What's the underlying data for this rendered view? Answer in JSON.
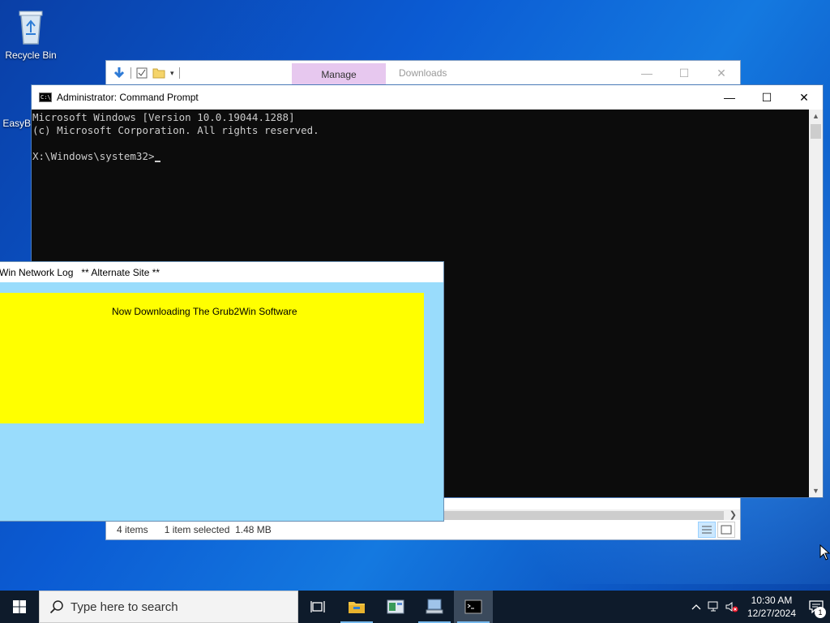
{
  "desktop": {
    "icons": [
      {
        "label": "Recycle Bin",
        "icon": "recycle-bin-icon"
      },
      {
        "label": "EasyB",
        "icon": "easybcd-icon"
      }
    ]
  },
  "explorer": {
    "manage_tab": "Manage",
    "title": "Downloads",
    "status": {
      "items": "4 items",
      "selected": "1 item selected  1.48 MB"
    }
  },
  "cmd": {
    "title": "Administrator: Command Prompt",
    "lines": [
      "Microsoft Windows [Version 10.0.19044.1288]",
      "(c) Microsoft Corporation. All rights reserved.",
      "",
      "X:\\Windows\\system32>"
    ]
  },
  "grub": {
    "title": "Win Network Log   ** Alternate Site **",
    "message": "Now Downloading The Grub2Win Software",
    "colors": {
      "panel": "#ffff00",
      "background": "#99dcfc"
    }
  },
  "taskbar": {
    "search_placeholder": "Type here to search",
    "apps": [
      "task-view-icon",
      "file-explorer-icon",
      "control-panel-icon",
      "network-computer-icon",
      "command-prompt-icon"
    ],
    "clock": {
      "time": "10:30 AM",
      "date": "12/27/2024"
    },
    "notification_count": "1"
  },
  "colors": {
    "taskbar": "#0e1b2b",
    "accent": "#76b9ed"
  }
}
